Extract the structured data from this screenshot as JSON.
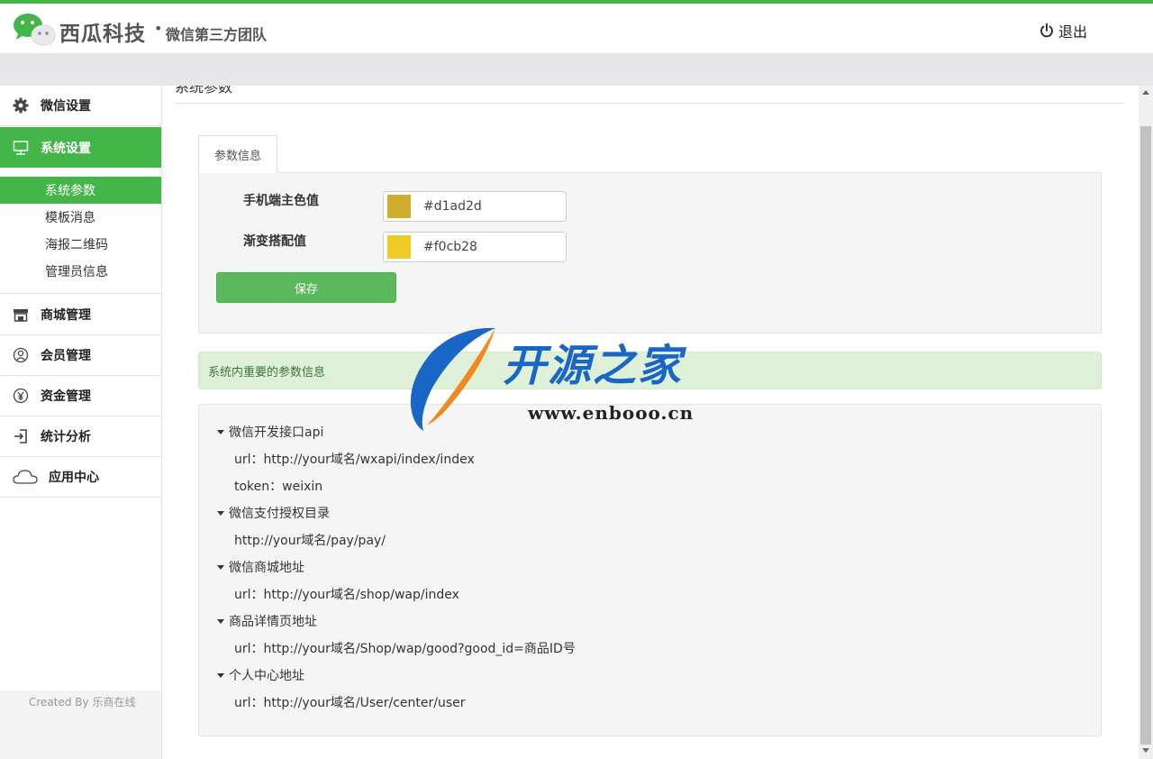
{
  "header": {
    "brand": "西瓜科技",
    "dot": "•",
    "subtitle": "微信第三方团队",
    "logout_label": "退出"
  },
  "sidebar": {
    "items": [
      {
        "label": "微信设置",
        "icon": "gear-icon"
      },
      {
        "label": "系统设置",
        "icon": "monitor-icon"
      },
      {
        "label": "商城管理",
        "icon": "store-icon"
      },
      {
        "label": "会员管理",
        "icon": "user-circle-icon"
      },
      {
        "label": "资金管理",
        "icon": "yen-icon"
      },
      {
        "label": "统计分析",
        "icon": "sign-in-icon"
      },
      {
        "label": "应用中心",
        "icon": "cloud-icon"
      }
    ],
    "sub_items": [
      "系统参数",
      "模板消息",
      "海报二维码",
      "管理员信息"
    ],
    "footer": "Created By 乐商在线"
  },
  "main": {
    "page_title": "系统参数",
    "tab_label": "参数信息",
    "form": {
      "primary_label": "手机端主色值",
      "primary_value": "#d1ad2d",
      "gradient_label": "渐变搭配值",
      "gradient_value": "#f0cb28",
      "save_label": "保存"
    },
    "alert": "系统内重要的参数信息",
    "info": [
      {
        "head": "微信开发接口api",
        "values": [
          "url：http://your域名/wxapi/index/index",
          "token：weixin"
        ]
      },
      {
        "head": "微信支付授权目录",
        "values": [
          "http://your域名/pay/pay/"
        ]
      },
      {
        "head": "微信商城地址",
        "values": [
          "url：http://your域名/shop/wap/index"
        ]
      },
      {
        "head": "商品详情页地址",
        "values": [
          "url：http://your域名/Shop/wap/good?good_id=商品ID号"
        ]
      },
      {
        "head": "个人中心地址",
        "values": [
          "url：http://your域名/User/center/user"
        ]
      }
    ]
  },
  "watermark": {
    "text": "开源之家",
    "url": "www.enbooo.cn"
  },
  "colors": {
    "accent": "#44b549",
    "primary_swatch": "#d1ad2d",
    "gradient_swatch": "#f0cb28",
    "save_button": "#5cb85c",
    "alert_bg": "#dff0d8"
  }
}
